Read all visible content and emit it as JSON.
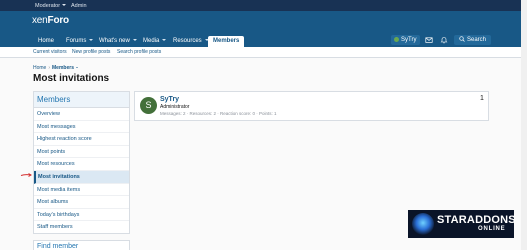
{
  "topbar": {
    "moderator_label": "Moderator",
    "admin_label": "Admin"
  },
  "header": {
    "logo_part1": "xen",
    "logo_part2": "Foro"
  },
  "nav": {
    "tabs": [
      {
        "label": "Home"
      },
      {
        "label": "Forums"
      },
      {
        "label": "What's new"
      },
      {
        "label": "Media"
      },
      {
        "label": "Resources"
      },
      {
        "label": "Members"
      }
    ],
    "user_label": "SyTry",
    "search_label": "Search"
  },
  "subnav": {
    "items": [
      {
        "label": "Current visitors"
      },
      {
        "label": "New profile posts"
      },
      {
        "label": "Search profile posts"
      }
    ]
  },
  "breadcrumb": {
    "home": "Home",
    "members": "Members"
  },
  "page": {
    "title": "Most invitations"
  },
  "sidebar": {
    "heading": "Members",
    "items": [
      {
        "label": "Overview"
      },
      {
        "label": "Most messages"
      },
      {
        "label": "Highest reaction score"
      },
      {
        "label": "Most points"
      },
      {
        "label": "Most resources"
      },
      {
        "label": "Most invitations"
      },
      {
        "label": "Most media items"
      },
      {
        "label": "Most albums"
      },
      {
        "label": "Today's birthdays"
      },
      {
        "label": "Staff members"
      }
    ],
    "selected_index": 5,
    "find_member_heading": "Find member"
  },
  "member": {
    "avatar_letter": "S",
    "avatar_color": "#43703a",
    "name": "SyTry",
    "title": "Administrator",
    "stats": "Messages: 2 · Resources: 2 · Reaction score: 0 · Points: 1",
    "count": "1"
  },
  "watermark": {
    "line1": "STARADDONS",
    "line2": "ONLINE"
  },
  "colors": {
    "topbar": "#183254",
    "header": "#185886",
    "accent": "#2577b1",
    "arrow": "#d32f2f"
  }
}
